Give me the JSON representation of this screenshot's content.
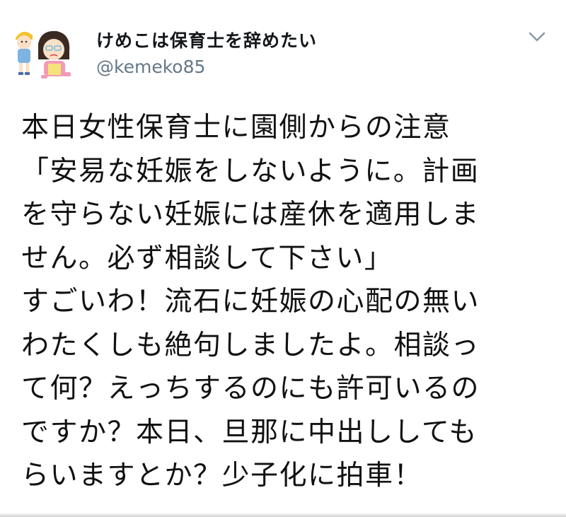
{
  "tweet": {
    "display_name": "けめこは保育士を辞めたい",
    "handle": "@kemeko85",
    "avatar_icon": "avatar-illustration-icon",
    "menu_icon": "chevron-down-icon",
    "body_lines": [
      "本日女性保育士に園側からの注意",
      "「安易な妊娠をしないように。計画",
      "を守らない妊娠には産休を適用しま",
      "せん。必ず相談して下さい」",
      "すごいわ！流石に妊娠の心配の無い",
      "わたくしも絶句しましたよ。相談っ",
      "て何？えっちするのにも許可いるの",
      "ですか？本日、旦那に中出ししても",
      "らいますとか？少子化に拍車！"
    ]
  },
  "colors": {
    "name": "#14171a",
    "handle": "#657786",
    "caret": "#8899a6"
  }
}
